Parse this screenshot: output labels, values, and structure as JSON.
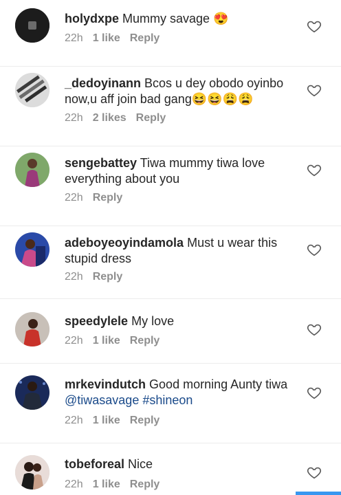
{
  "colors": {
    "accent": "#3897f0",
    "link": "#1a4a8a",
    "meta": "#8e8e8e"
  },
  "comments": [
    {
      "user": "holydxpe",
      "text": "Mummy savage 😍",
      "time": "22h",
      "likes": "1 like",
      "reply": "Reply"
    },
    {
      "user": "_dedoyinann",
      "text": "Bcos u dey obodo oyinbo now,u aff join bad gang😆😆😩😩",
      "time": "22h",
      "likes": "2 likes",
      "reply": "Reply"
    },
    {
      "user": "sengebattey",
      "text": "Tiwa mummy tiwa love everything about you",
      "time": "22h",
      "reply": "Reply"
    },
    {
      "user": "adeboyeoyindamola",
      "text": "Must u wear this stupid dress",
      "time": "22h",
      "reply": "Reply"
    },
    {
      "user": "speedylele",
      "text": "My love",
      "time": "22h",
      "likes": "1 like",
      "reply": "Reply"
    },
    {
      "user": "mrkevindutch",
      "text_before": "Good morning Aunty tiwa ",
      "mention": "@tiwasavage",
      "hashtag": "#shineon",
      "time": "22h",
      "likes": "1 like",
      "reply": "Reply"
    },
    {
      "user": "tobeforeal",
      "text": "Nice",
      "time": "22h",
      "likes": "1 like",
      "reply": "Reply"
    }
  ]
}
